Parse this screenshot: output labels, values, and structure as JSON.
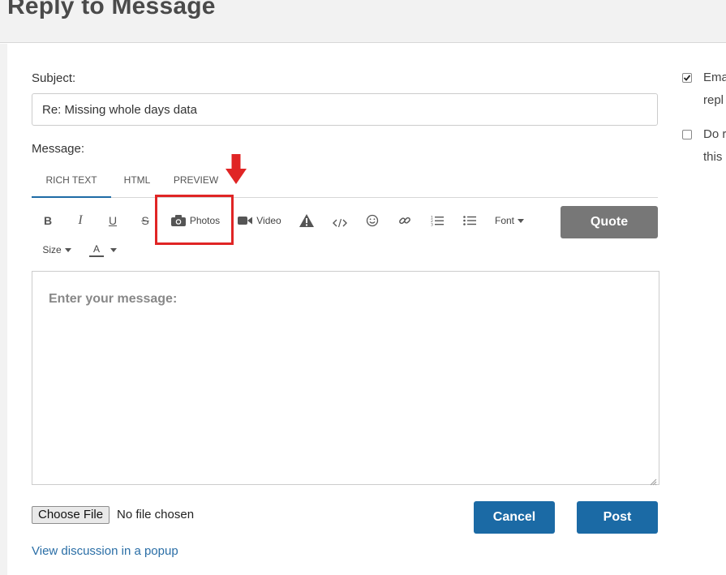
{
  "page": {
    "title": "Reply to Message"
  },
  "form": {
    "subject_label": "Subject:",
    "subject_value": "Re: Missing whole days data",
    "message_label": "Message:",
    "tabs": [
      {
        "label": "RICH TEXT",
        "active": true
      },
      {
        "label": "HTML",
        "active": false
      },
      {
        "label": "PREVIEW",
        "active": false
      }
    ],
    "toolbar": {
      "bold": "B",
      "italic": "I",
      "underline": "U",
      "strike": "S",
      "photos": "Photos",
      "video": "Video",
      "font": "Font",
      "size": "Size",
      "color": "A",
      "quote": "Quote"
    },
    "editor_placeholder": "Enter your message:",
    "file": {
      "button": "Choose File",
      "status": "No file chosen"
    },
    "cancel_label": "Cancel",
    "post_label": "Post",
    "popup_link": "View discussion in a popup"
  },
  "sidebar": {
    "options": [
      {
        "line1": "Ema",
        "line2": "repl",
        "checked": true
      },
      {
        "line1": "Do r",
        "line2": "this",
        "checked": false
      }
    ]
  },
  "colors": {
    "accent_blue": "#1b6aa5",
    "highlight_red": "#e02525",
    "quote_gray": "#777777"
  }
}
